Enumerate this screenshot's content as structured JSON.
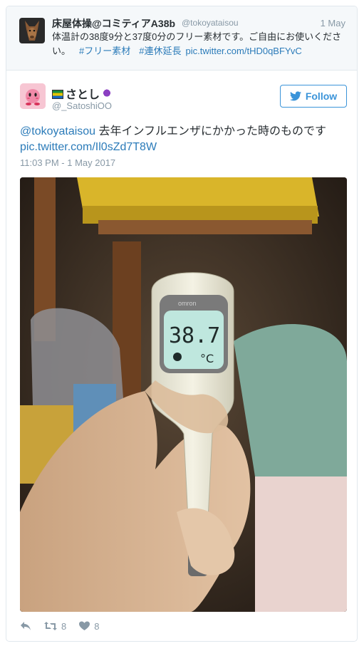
{
  "parent_tweet": {
    "name": "床屋体操@コミティアA38b",
    "handle": "@tokoyataisou",
    "date": "1 May",
    "text": "体温計の38度9分と37度0分のフリー素材です。ご自由にお使いください。",
    "hashtag1": "#フリー素材",
    "hashtag2": "#連休延長",
    "link": "pic.twitter.com/tHD0qBFYvC"
  },
  "tweet": {
    "name": "さとし",
    "handle": "@_SatoshiOO",
    "follow_label": "Follow",
    "mention": "@tokoyataisou",
    "text": " 去年インフルエンザにかかった時のものです",
    "link": "pic.twitter.com/Il0sZd7T8W",
    "timestamp": "11:03 PM - 1 May 2017"
  },
  "photo": {
    "thermometer_brand": "omron",
    "reading": "38.7",
    "unit": "°C"
  },
  "actions": {
    "retweets": "8",
    "likes": "8"
  },
  "colors": {
    "accent": "#3b94d9",
    "link": "#2b7bb9",
    "muted": "#8899a6"
  },
  "icons": [
    "reply-icon",
    "retweet-icon",
    "heart-icon",
    "twitter-bird-icon"
  ]
}
